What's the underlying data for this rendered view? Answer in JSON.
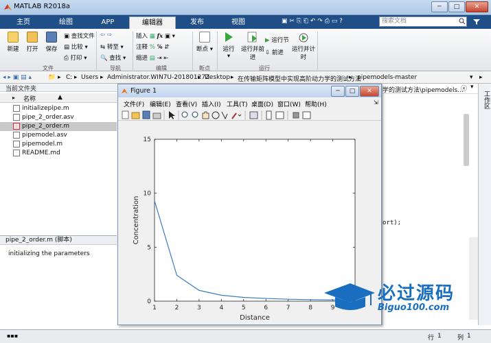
{
  "window": {
    "title": "MATLAB R2018a",
    "minimize": "─",
    "maximize": "□",
    "close": "✕"
  },
  "tabs": [
    {
      "label": "主页"
    },
    {
      "label": "绘图"
    },
    {
      "label": "APP"
    },
    {
      "label": "编辑器",
      "active": true
    },
    {
      "label": "发布"
    },
    {
      "label": "视图"
    }
  ],
  "search": {
    "placeholder": "搜索文档"
  },
  "ribbon": {
    "new_label": "新建",
    "open_label": "打开",
    "save_label": "保存",
    "find_files": "查找文件",
    "compare": "比较",
    "print": "打印",
    "goto": "转至",
    "find": "查找",
    "insert": "插入",
    "comment": "注释",
    "indent": "缩进",
    "fx": "fx",
    "breakpoints": "断点",
    "run": "运行",
    "run_advance": "运行并前进",
    "run_section": "运行节",
    "advance": "前进",
    "run_time": "运行并计时",
    "groups": {
      "file": "文件",
      "navigate": "导航",
      "edit": "编辑",
      "breakpoints": "断点",
      "run": "运行"
    }
  },
  "path": [
    "C:",
    "Users",
    "Administrator.WIN7U-20180127Z",
    "Desktop",
    "在传输矩阵模型中实现高阶动力学的测试方法",
    "pipemodels-master"
  ],
  "left_panel": {
    "title": "当前文件夹",
    "column_name": "名称",
    "files": [
      {
        "name": "initializepipe.m",
        "selected": false
      },
      {
        "name": "pipe_2_order.asv",
        "selected": false
      },
      {
        "name": "pipe_2_order.m",
        "selected": true
      },
      {
        "name": "pipemodel.asv",
        "selected": false
      },
      {
        "name": "pipemodel.m",
        "selected": false
      },
      {
        "name": "README.md",
        "selected": false
      }
    ],
    "detail_header": "pipe_2_order.m  (脚本)",
    "detail_text": "initializing the parameters"
  },
  "editor_bg": {
    "path_tail": "学的测试方法\\pipemodels...",
    "code_fragment": "ort);"
  },
  "workspace_label": "工作区",
  "figure": {
    "title": "Figure 1",
    "menu": [
      "文件(F)",
      "编辑(E)",
      "查看(V)",
      "插入(I)",
      "工具(T)",
      "桌面(D)",
      "窗口(W)",
      "帮助(H)"
    ]
  },
  "chart_data": {
    "type": "line",
    "title": "",
    "xlabel": "Distance",
    "ylabel": "Concentration",
    "xlim": [
      1,
      10
    ],
    "ylim": [
      0,
      15
    ],
    "xticks": [
      1,
      2,
      3,
      4,
      5,
      6,
      7,
      8,
      9,
      10
    ],
    "yticks": [
      0,
      5,
      10,
      15
    ],
    "grid": false,
    "series": [
      {
        "color": "#3b7bbf",
        "x": [
          1,
          2,
          3,
          4,
          5,
          6,
          7,
          8,
          9,
          10
        ],
        "y": [
          9.3,
          2.4,
          1.0,
          0.55,
          0.35,
          0.25,
          0.18,
          0.14,
          0.11,
          0.1
        ]
      }
    ]
  },
  "status": {
    "line_label": "行",
    "line": "1",
    "col_label": "列",
    "col": "1"
  },
  "watermark": {
    "line1": "必过源码",
    "line2": "Biguo100.com"
  }
}
